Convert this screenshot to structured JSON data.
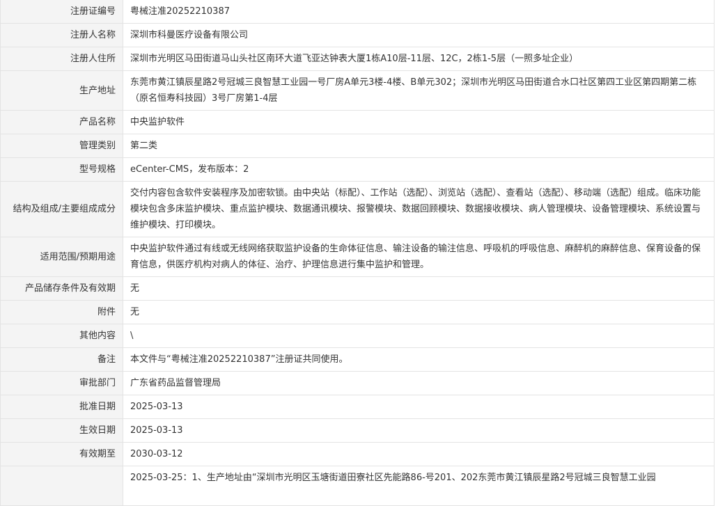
{
  "rows": [
    {
      "label": "注册证编号",
      "value": "粤械注准20252210387"
    },
    {
      "label": "注册人名称",
      "value": "深圳市科曼医疗设备有限公司"
    },
    {
      "label": "注册人住所",
      "value": "深圳市光明区马田街道马山头社区南环大道飞亚达钟表大厦1栋A10层-11层、12C，2栋1-5层（一照多址企业）"
    },
    {
      "label": "生产地址",
      "value": "东莞市黄江镇辰星路2号冠城三良智慧工业园一号厂房A单元3楼-4楼、B单元302；深圳市光明区马田街道合水口社区第四工业区第四期第二栋（原名恒寿科技园）3号厂房第1-4层"
    },
    {
      "label": "产品名称",
      "value": "中央监护软件"
    },
    {
      "label": "管理类别",
      "value": "第二类"
    },
    {
      "label": "型号规格",
      "value": "eCenter-CMS，发布版本：2"
    },
    {
      "label": "结构及组成/主要组成成分",
      "value": "交付内容包含软件安装程序及加密软锁。由中央站（标配）、工作站（选配）、浏览站（选配）、查看站（选配）、移动端（选配）组成。临床功能模块包含多床监护模块、重点监护模块、数据通讯模块、报警模块、数据回顾模块、数据接收模块、病人管理模块、设备管理模块、系统设置与维护模块、打印模块。"
    },
    {
      "label": "适用范围/预期用途",
      "value": "中央监护软件通过有线或无线网络获取监护设备的生命体征信息、输注设备的输注信息、呼吸机的呼吸信息、麻醉机的麻醉信息、保育设备的保育信息，供医疗机构对病人的体征、治疗、护理信息进行集中监护和管理。"
    },
    {
      "label": "产品储存条件及有效期",
      "value": "无"
    },
    {
      "label": "附件",
      "value": "无"
    },
    {
      "label": "其他内容",
      "value": "\\"
    },
    {
      "label": "备注",
      "value": "本文件与“粤械注准20252210387”注册证共同使用。"
    },
    {
      "label": "审批部门",
      "value": "广东省药品监督管理局"
    },
    {
      "label": "批准日期",
      "value": "2025-03-13"
    },
    {
      "label": "生效日期",
      "value": "2025-03-13"
    },
    {
      "label": "有效期至",
      "value": "2030-03-12"
    },
    {
      "label": "",
      "value": "2025-03-25：1、生产地址由“深圳市光明区玉塘街道田寮社区先能路86-号201、202东莞市黄江镇辰星路2号冠城三良智慧工业园"
    }
  ]
}
